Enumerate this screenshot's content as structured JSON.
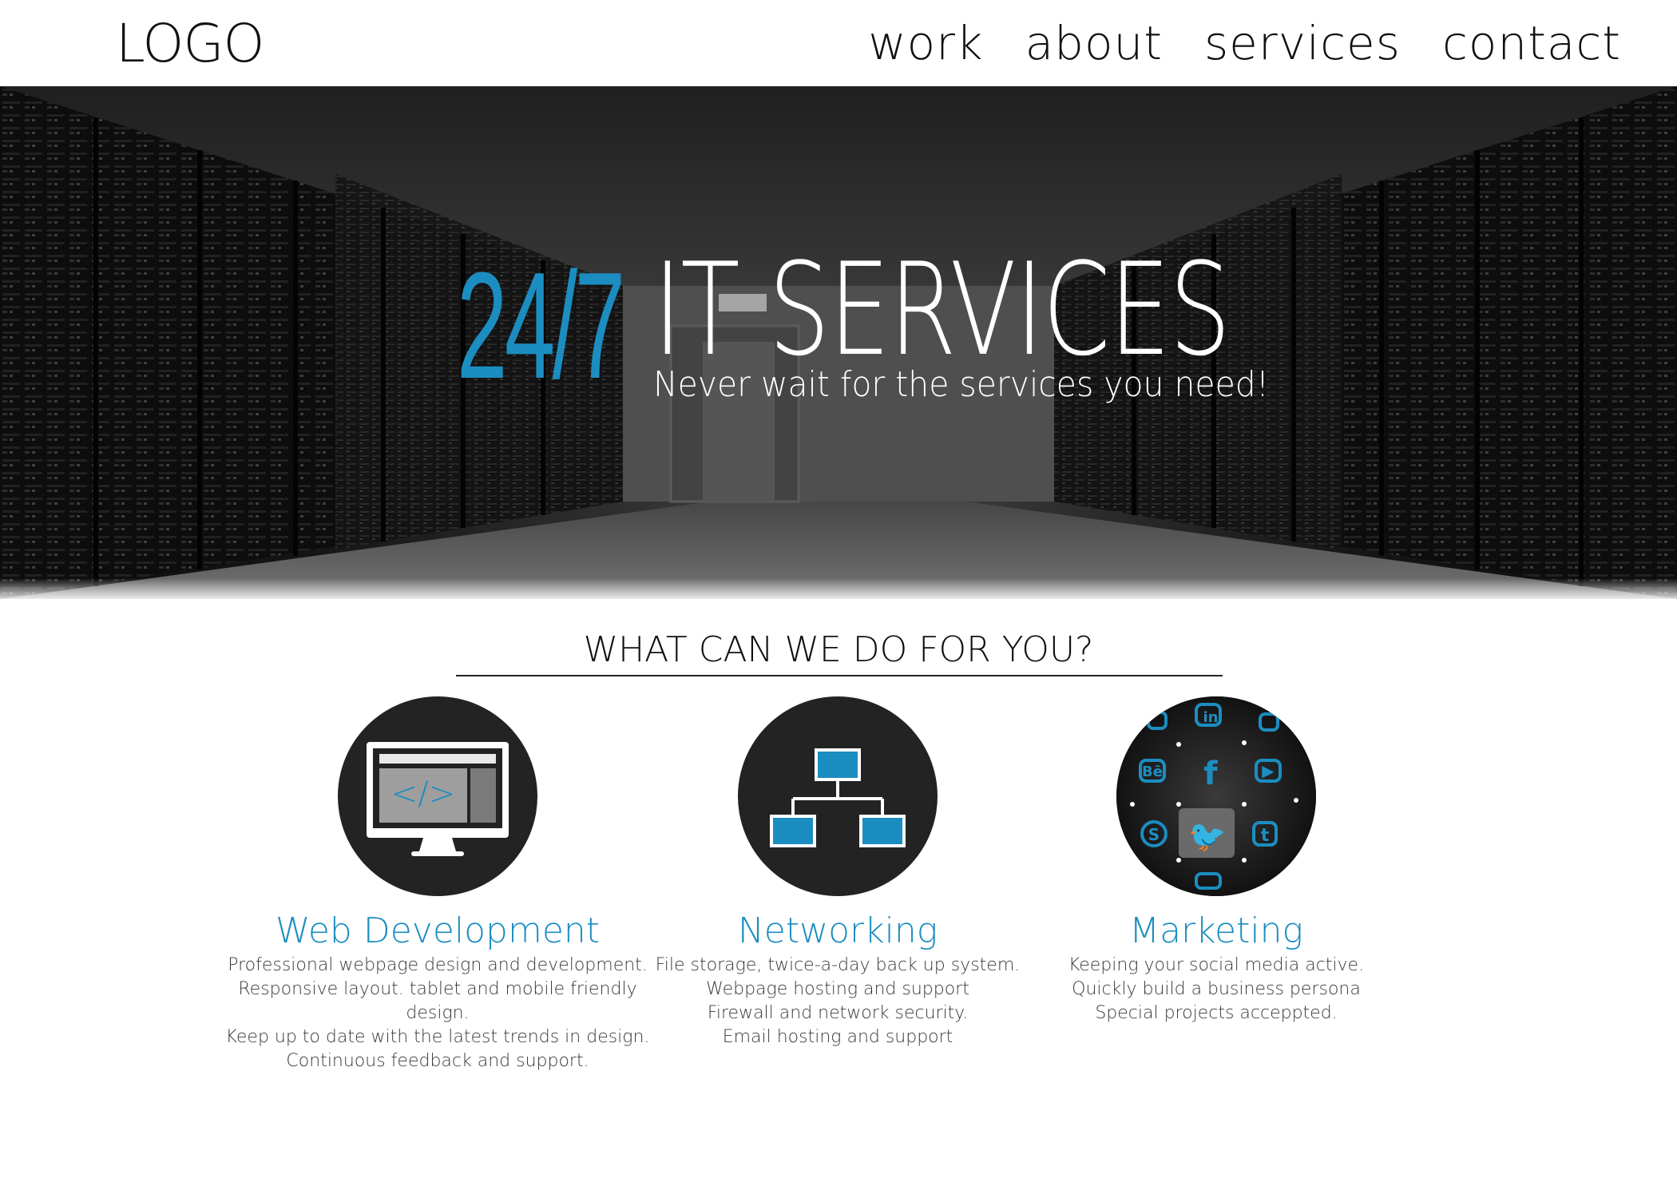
{
  "header": {
    "logo": "LOGO",
    "nav": [
      "work",
      "about",
      "services",
      "contact"
    ]
  },
  "hero": {
    "big": "24/7",
    "title": "IT SERVICES",
    "subtitle": "Never wait for the services you need!"
  },
  "section": {
    "title": "WHAT CAN WE DO FOR YOU?"
  },
  "services": [
    {
      "name": "Web Development",
      "icon": "monitor-code-icon",
      "lines": [
        "Professional webpage design and development.",
        "Responsive layout. tablet and mobile friendly design.",
        "Keep up to date with the latest trends in design.",
        "Continuous feedback and support."
      ]
    },
    {
      "name": "Networking",
      "icon": "network-hierarchy-icon",
      "lines": [
        "File storage, twice-a-day back up system.",
        "Webpage hosting and support",
        "Firewall and network security.",
        "Email hosting and support"
      ]
    },
    {
      "name": "Marketing",
      "icon": "social-media-globe-icon",
      "lines": [
        "Keeping your social media active.",
        "Quickly build a business persona",
        "Special projects acceppted."
      ]
    }
  ],
  "colors": {
    "accent": "#1c8dc0",
    "dark": "#232323",
    "text": "#111111"
  }
}
